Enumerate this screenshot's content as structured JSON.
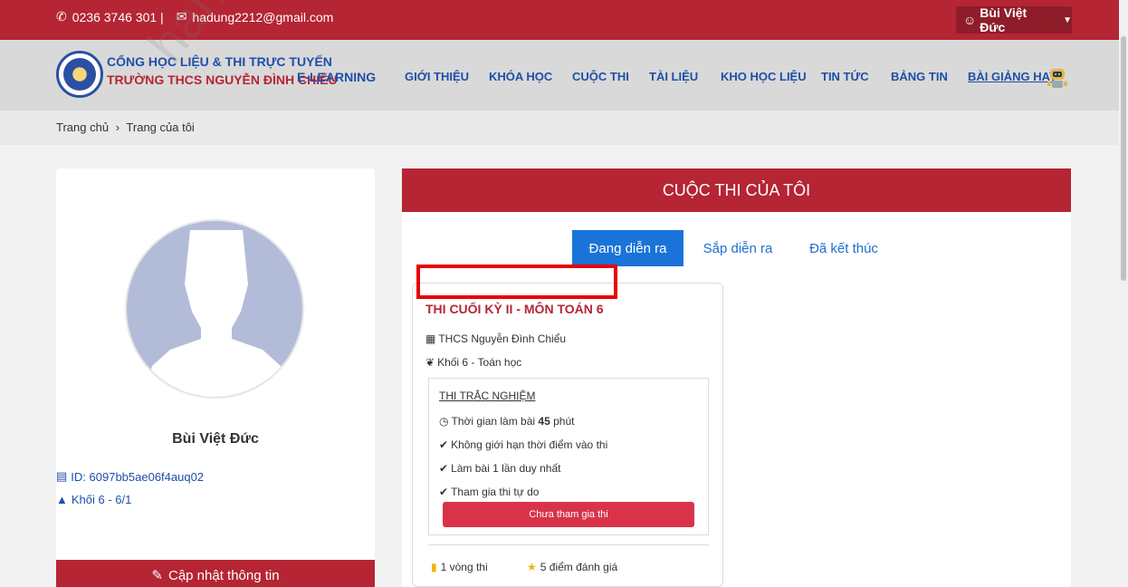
{
  "topbar": {
    "phone": "0236 3746 301 |",
    "email": "hadung2212@gmail.com",
    "user_name": "Bùi Việt Đức"
  },
  "header": {
    "brand_line1": "CỔNG HỌC LIỆU & THI TRỰC TUYẾN",
    "brand_line2": "TRƯỜNG THCS NGUYỄN ĐÌNH CHIỂU",
    "brand_suffix": "E-LEARNING",
    "nav": [
      "GIỚI THIỆU",
      "KHÓA HỌC",
      "CUỘC THI",
      "TÀI LIỆU",
      "KHO HỌC LIỆU",
      "TIN TỨC",
      "BẢNG TIN",
      "BÀI GIẢNG HAY"
    ]
  },
  "breadcrumb": {
    "home": "Trang chủ",
    "separator": "›",
    "current": "Trang của tôi"
  },
  "profile": {
    "name": "Bùi Việt Đức",
    "id_text": "ID: 6097bb5ae06f4auq02",
    "grade_text": "Khối 6 - 6/1",
    "update_label": "Cập nhật thông tin"
  },
  "contests": {
    "title": "CUỘC THI CỦA TÔI",
    "tabs": [
      "Đang diễn ra",
      "Sắp diễn ra",
      "Đã kết thúc"
    ],
    "active_tab": "Đang diễn ra",
    "card": {
      "name": "THI CUỐI KỲ II - MÔN TOÁN 6",
      "school": "THCS Nguyễn Đình Chiểu",
      "subject": "Khối 6 - Toán học",
      "type": "THI TRẮC NGHIỆM",
      "time_prefix": "Thời gian làm bài ",
      "time_value": "45",
      "time_suffix": " phút",
      "rule1": "Không giới hạn thời điểm vào thi",
      "rule2": "Làm bài 1 lần duy nhất",
      "rule3": "Tham gia thi tự do",
      "join_label": "Chưa tham gia thi",
      "rounds": "1 vòng thi",
      "rating": "5 điểm đánh giá"
    }
  },
  "watermark": "hanhtd.1234",
  "colors": {
    "primary_red": "#b52534",
    "link_blue": "#1f4fa8",
    "tab_blue": "#1a73d8",
    "highlight_box": "#e80000"
  }
}
